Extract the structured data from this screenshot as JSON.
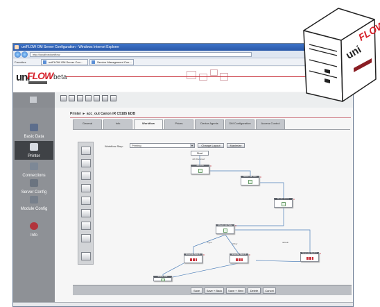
{
  "browser": {
    "title": "uniFLOW OM Server Configuration - Windows Internet Explorer",
    "address": "http://localhost/uniflow",
    "favorites": "Favorites",
    "tabs": [
      "uniFLOW OM Server Con...",
      "Service Management Con..."
    ]
  },
  "app": {
    "logo_uni": "uni",
    "logo_flow": "FLOW",
    "edition": "beta",
    "brand_color": "#d6202a"
  },
  "sidebar": {
    "items": [
      {
        "label": "Basic Data",
        "icon": "database-icon"
      },
      {
        "label": "Printer",
        "icon": "printer-icon"
      },
      {
        "label": "Connections",
        "icon": "network-icon"
      },
      {
        "label": "Server Config",
        "icon": "server-icon"
      },
      {
        "label": "Module Config",
        "icon": "puzzle-icon"
      },
      {
        "label": "Info",
        "icon": "info-icon"
      }
    ],
    "active_index": 1
  },
  "main": {
    "path": "Printer ► acc_out Canon iR C5185 EDB",
    "tabs": [
      "General",
      "Info",
      "Workflow",
      "Prices",
      "Device Agents",
      "DM Configuration",
      "Access Control"
    ],
    "active_tab_index": 2,
    "workflow_label": "Workflow Step:",
    "workflow_value": "Printing",
    "btn_change_layout": "Change Layout",
    "btn_maximize": "Maximize"
  },
  "workflow": {
    "start": "Start",
    "start_sub": "Job Received",
    "nodes": [
      {
        "label": "Job Info"
      },
      {
        "label": "Show Job Info"
      },
      {
        "label": "Route Job to"
      },
      {
        "label": "Check Job Size"
      },
      {
        "label": "Execute Mod A"
      },
      {
        "label": "Execute Mod B"
      },
      {
        "label": "Execute Mod C"
      },
      {
        "label": "Route Job"
      }
    ],
    "branch_labels": [
      "Type",
      "Other",
      "default"
    ]
  },
  "buttons": [
    "Save",
    "Save + Back",
    "Save + Next",
    "Delete",
    "Cancel"
  ],
  "illustration": {
    "uni": "uni",
    "flow": "FLOW"
  }
}
